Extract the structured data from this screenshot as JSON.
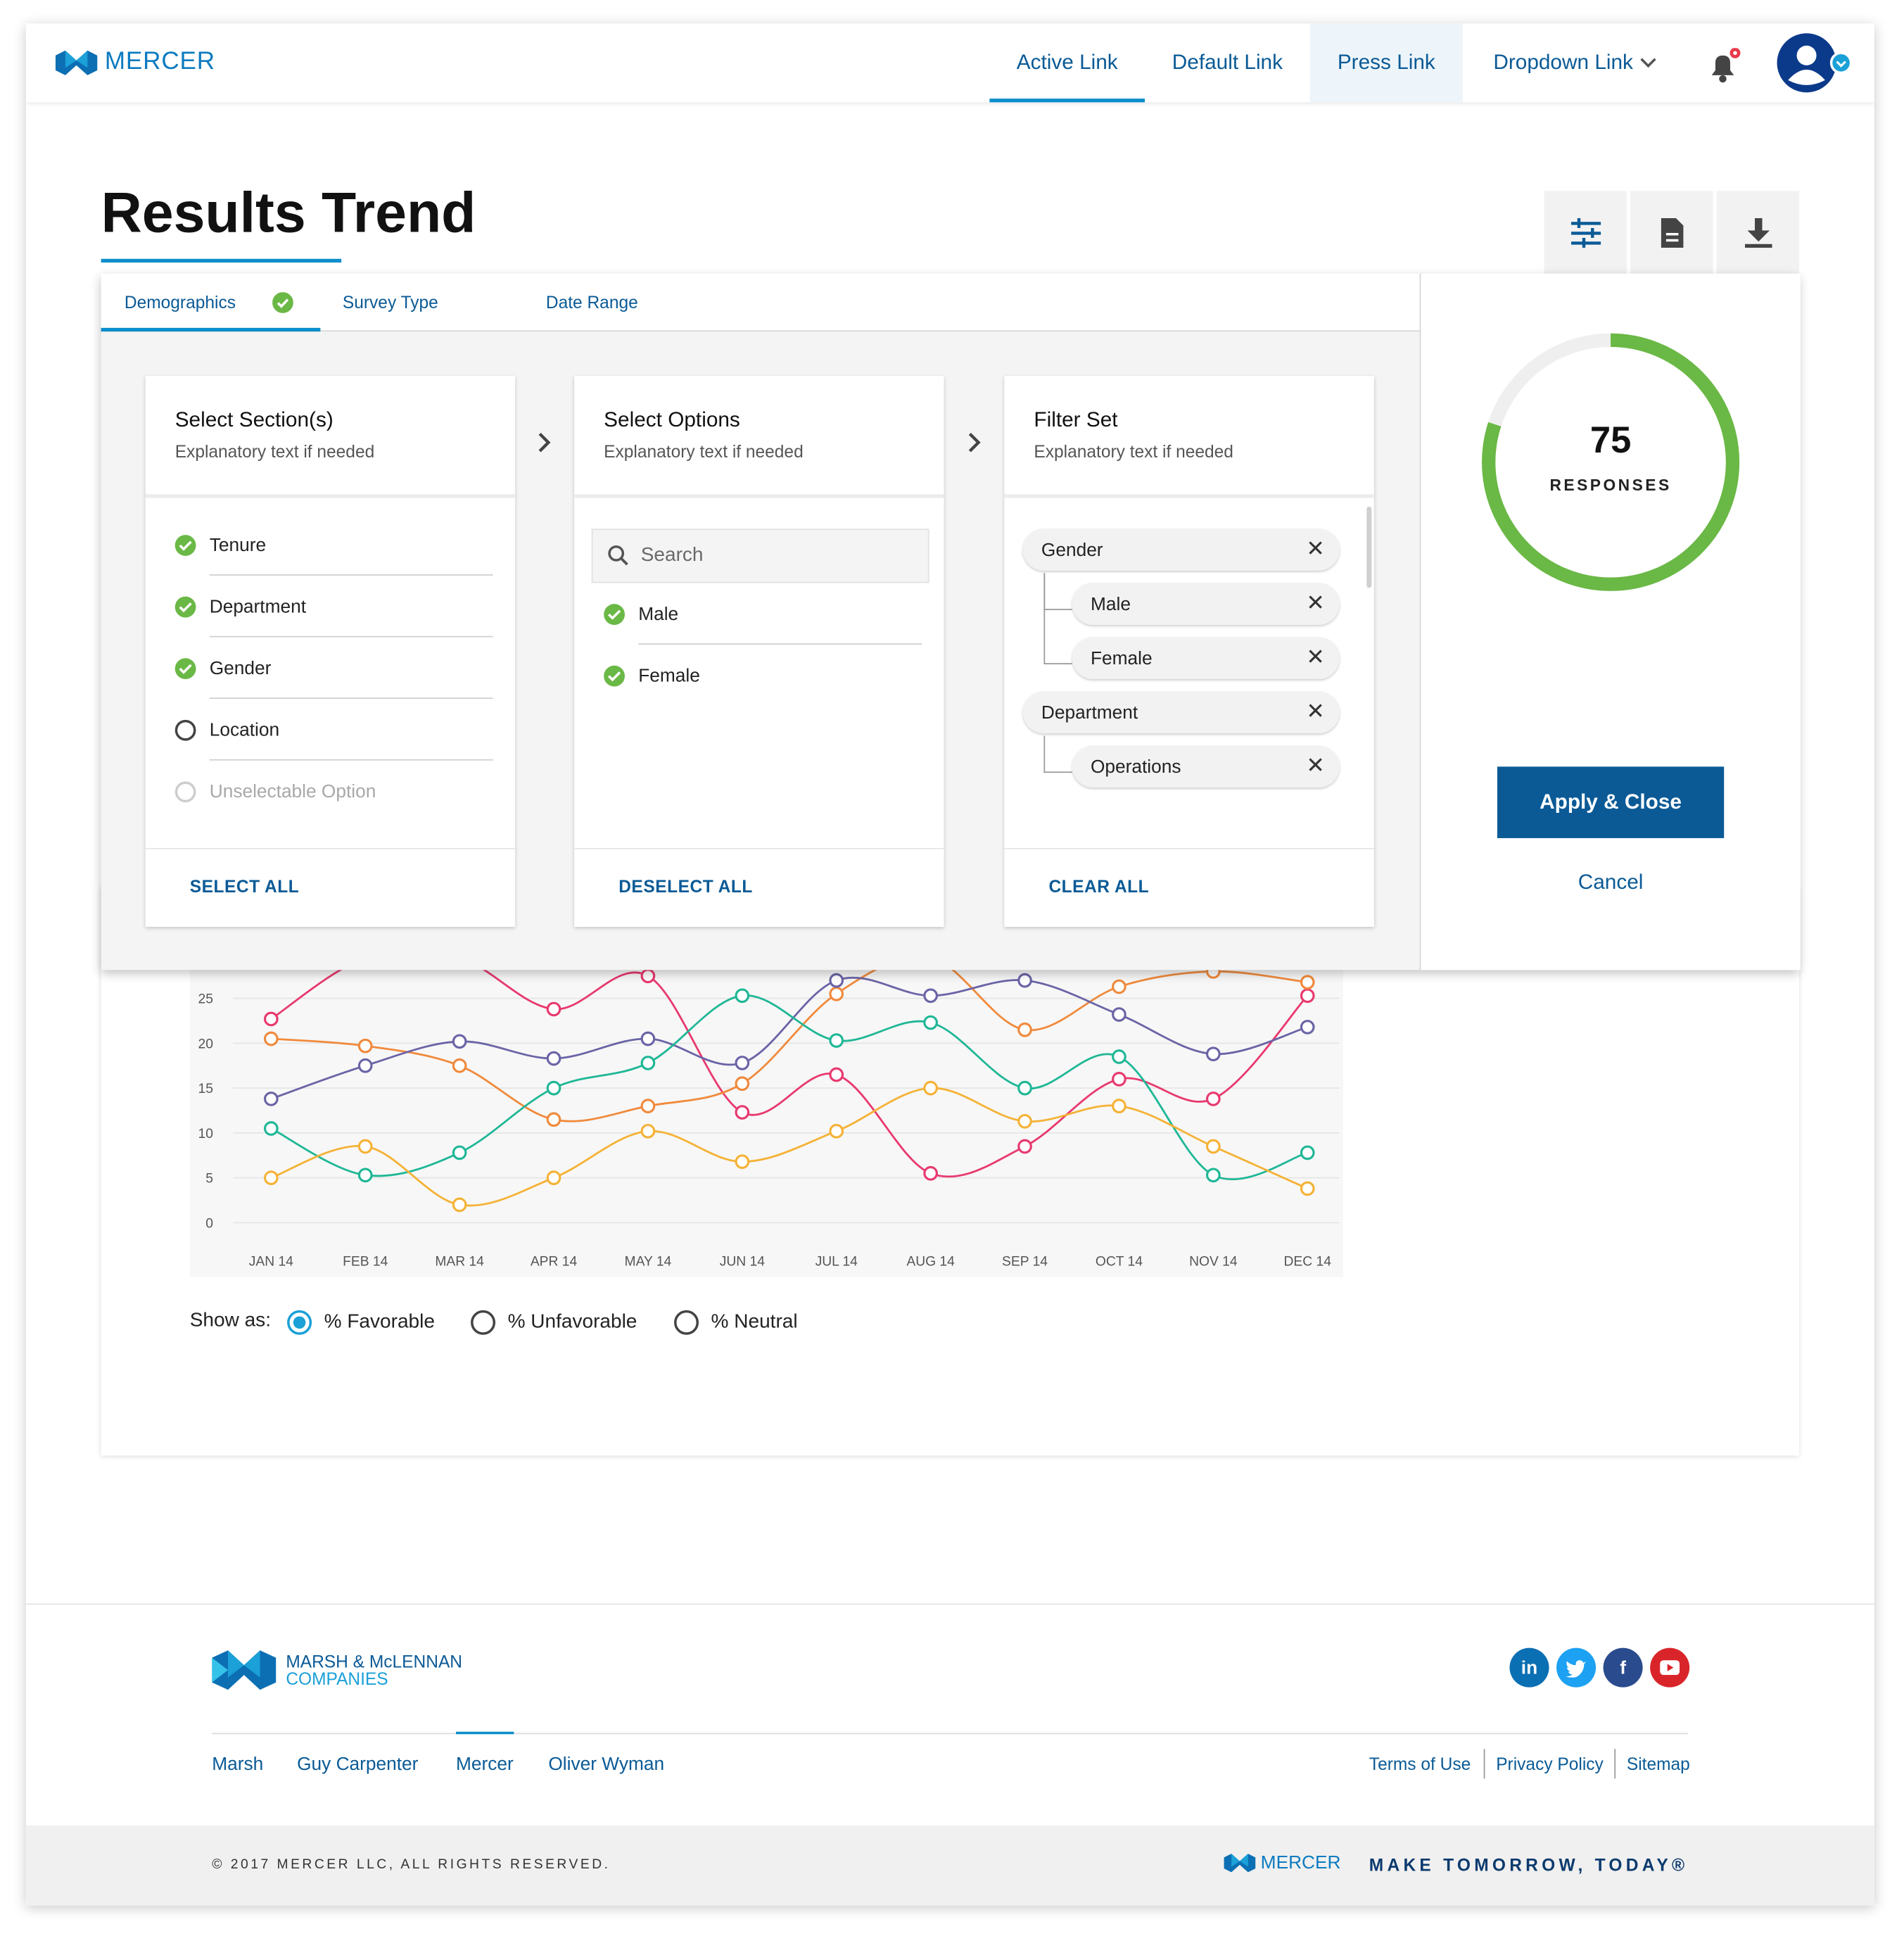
{
  "header": {
    "logo": "MERCER",
    "nav": [
      {
        "label": "Active Link"
      },
      {
        "label": "Default Link"
      },
      {
        "label": "Press Link"
      },
      {
        "label": "Dropdown Link"
      }
    ]
  },
  "page": {
    "title": "Results Trend"
  },
  "filter": {
    "tabs": [
      {
        "label": "Demographics",
        "complete": true
      },
      {
        "label": "Survey Type"
      },
      {
        "label": "Date Range"
      }
    ],
    "sections": {
      "title": "Select Section(s)",
      "subtitle": "Explanatory text if needed",
      "items": [
        {
          "label": "Tenure",
          "state": "checked"
        },
        {
          "label": "Department",
          "state": "checked"
        },
        {
          "label": "Gender",
          "state": "checked"
        },
        {
          "label": "Location",
          "state": "unchecked"
        },
        {
          "label": "Unselectable Option",
          "state": "disabled"
        }
      ],
      "footer": "SELECT ALL"
    },
    "options": {
      "title": "Select Options",
      "subtitle": "Explanatory text if needed",
      "search_placeholder": "Search",
      "items": [
        {
          "label": "Male",
          "state": "checked"
        },
        {
          "label": "Female",
          "state": "checked"
        }
      ],
      "footer": "DESELECT ALL"
    },
    "filter_set": {
      "title": "Filter Set",
      "subtitle": "Explanatory text if needed",
      "chips": [
        {
          "label": "Gender",
          "level": 0
        },
        {
          "label": "Male",
          "level": 1
        },
        {
          "label": "Female",
          "level": 1
        },
        {
          "label": "Department",
          "level": 0
        },
        {
          "label": "Operations",
          "level": 1
        }
      ],
      "footer": "CLEAR ALL"
    },
    "responses": {
      "count": "75",
      "label": "RESPONSES",
      "progress": 0.8
    },
    "apply_label": "Apply & Close",
    "cancel_label": "Cancel"
  },
  "chart_data": {
    "type": "line",
    "categories": [
      "JAN 14",
      "FEB 14",
      "MAR 14",
      "APR 14",
      "MAY 14",
      "JUN 14",
      "JUL 14",
      "AUG 14",
      "SEP 14",
      "OCT 14",
      "NOV 14",
      "DEC 14"
    ],
    "y_ticks": [
      "0",
      "5",
      "10",
      "15",
      "20",
      "25"
    ],
    "ylim": [
      0,
      30
    ],
    "grid": true,
    "series": [
      {
        "color": "#e8396e",
        "values": [
          22.7,
          29.5,
          29.5,
          23.8,
          27.5,
          12.3,
          16.5,
          5.5,
          8.5,
          16.0,
          13.8,
          25.3
        ]
      },
      {
        "color": "#f08a3c",
        "values": [
          20.5,
          19.7,
          17.5,
          11.5,
          13.0,
          15.5,
          25.5,
          29.5,
          21.5,
          26.3,
          28.0,
          26.8
        ]
      },
      {
        "color": "#6a64a6",
        "values": [
          13.8,
          17.5,
          20.2,
          18.3,
          20.5,
          17.8,
          27.0,
          25.3,
          27.0,
          23.2,
          18.8,
          21.8
        ]
      },
      {
        "color": "#1fb796",
        "values": [
          10.5,
          5.3,
          7.8,
          15.0,
          17.8,
          25.3,
          20.3,
          22.3,
          15.0,
          18.5,
          5.3,
          7.8
        ]
      },
      {
        "color": "#f5b236",
        "values": [
          5.0,
          8.5,
          2.0,
          5.0,
          10.2,
          6.8,
          10.2,
          15.0,
          11.3,
          13.0,
          8.5,
          3.8
        ]
      }
    ]
  },
  "show_as": {
    "label": "Show as:",
    "options": [
      {
        "label": "% Favorable",
        "selected": true
      },
      {
        "label": "% Unfavorable"
      },
      {
        "label": "% Neutral"
      }
    ]
  },
  "footer": {
    "brand_line1": "MARSH & McLENNAN",
    "brand_line2": "COMPANIES",
    "links": [
      "Marsh",
      "Guy Carpenter",
      "Mercer",
      "Oliver Wyman"
    ],
    "legal": [
      "Terms of Use",
      "Privacy Policy",
      "Sitemap"
    ],
    "social": [
      "in",
      "twitter",
      "f",
      "youtube"
    ],
    "copyright": "© 2017 MERCER LLC, ALL RIGHTS RESERVED.",
    "logo": "MERCER",
    "tagline": "MAKE TOMORROW, TODAY®"
  }
}
